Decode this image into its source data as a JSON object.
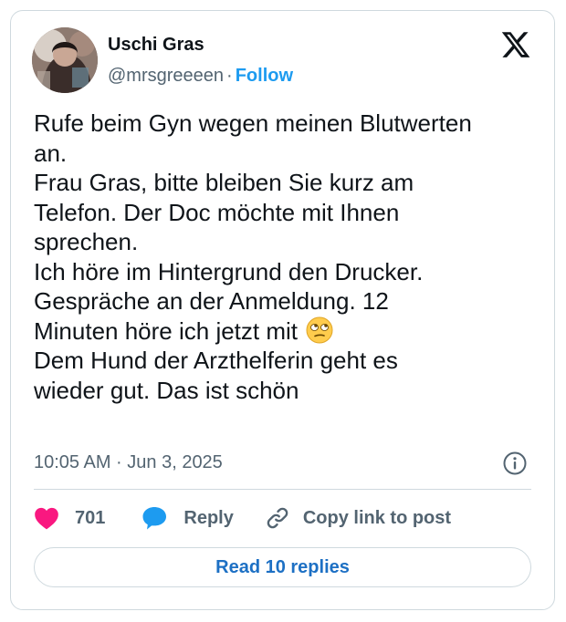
{
  "author": {
    "name": "Uschi Gras",
    "handle": "@mrsgreeeen",
    "separator": "·",
    "follow_label": "Follow"
  },
  "tweet": {
    "lines": [
      "Rufe beim Gyn wegen meinen Blutwerten",
      "an.",
      "Frau Gras, bitte bleiben Sie kurz am",
      "Telefon. Der Doc möchte mit Ihnen",
      "sprechen.",
      "Ich höre im Hintergrund den Drucker.",
      "Gespräche an der Anmeldung. 12",
      "Minuten höre ich jetzt mit",
      "Dem Hund der Arzthelferin geht es",
      "wieder gut. Das ist schön"
    ],
    "emoji": "face-with-rolling-eyes-emoji",
    "timestamp": "10:05 AM · Jun 3, 2025"
  },
  "actions": {
    "like_count": "701",
    "reply_label": "Reply",
    "copy_link_label": "Copy link to post"
  },
  "read_replies_label": "Read 10 replies",
  "icons": {
    "logo": "x-logo-icon",
    "info": "info-icon",
    "like": "heart-icon",
    "reply": "speech-bubble-icon",
    "copy": "link-icon"
  },
  "colors": {
    "like": "#f91880",
    "reply": "#1d9bf0",
    "link": "#1d9bf0",
    "border": "#cfd9de",
    "secondary_text": "#536471"
  }
}
